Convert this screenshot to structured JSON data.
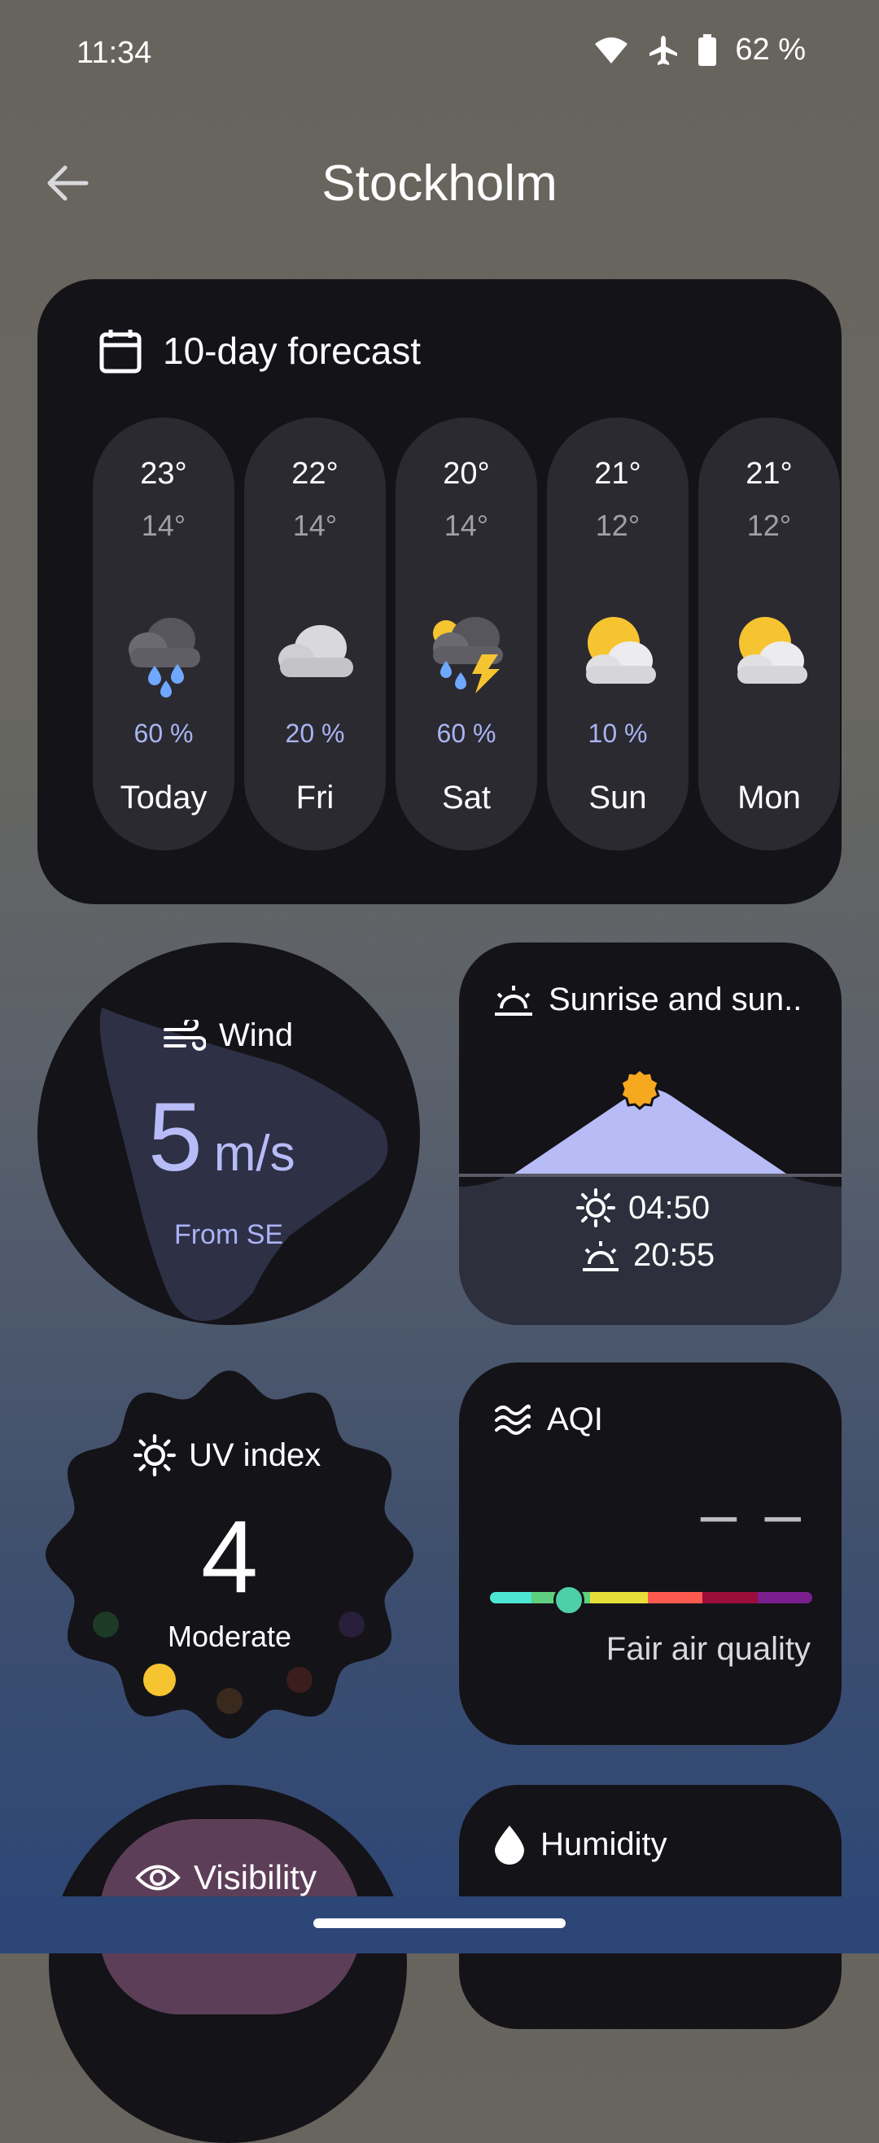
{
  "status": {
    "time": "11:34",
    "battery": "62 %"
  },
  "header": {
    "title": "Stockholm"
  },
  "forecast": {
    "title": "10-day forecast",
    "days": [
      {
        "name": "Today",
        "high": "23°",
        "low": "14°",
        "precip": "60 %",
        "icon": "rain-cloud-icon"
      },
      {
        "name": "Fri",
        "high": "22°",
        "low": "14°",
        "precip": "20 %",
        "icon": "cloud-icon"
      },
      {
        "name": "Sat",
        "high": "20°",
        "low": "14°",
        "precip": "60 %",
        "icon": "thunderstorm-icon"
      },
      {
        "name": "Sun",
        "high": "21°",
        "low": "12°",
        "precip": "10 %",
        "icon": "partly-cloudy-icon"
      },
      {
        "name": "Mon",
        "high": "21°",
        "low": "12°",
        "precip": "",
        "icon": "partly-cloudy-icon"
      }
    ]
  },
  "wind": {
    "label": "Wind",
    "value": "5",
    "unit": "m/s",
    "direction": "From SE"
  },
  "sun": {
    "label": "Sunrise and sun..",
    "sunrise": "04:50",
    "sunset": "20:55"
  },
  "uv": {
    "label": "UV index",
    "value": "4",
    "description": "Moderate"
  },
  "aqi": {
    "label": "AQI",
    "value": "– –",
    "description": "Fair air quality"
  },
  "visibility": {
    "label": "Visibility"
  },
  "humidity": {
    "label": "Humidity"
  },
  "colors": {
    "card": "#141318",
    "accent_blue": "#b7bcf7",
    "sun_yellow": "#f6c431",
    "aqi_scale": [
      "#4de6d3",
      "#5fd07f",
      "#e8e03a",
      "#ff5a4f",
      "#9b0d3b",
      "#7b1f8f"
    ]
  }
}
